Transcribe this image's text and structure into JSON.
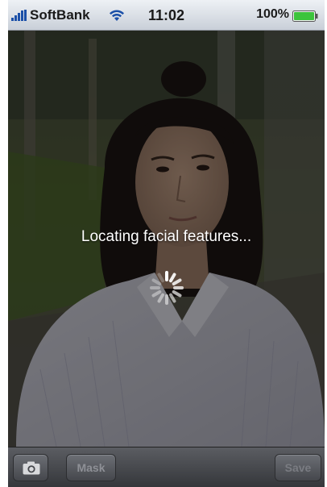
{
  "status_bar": {
    "carrier": "SoftBank",
    "time": "11:02",
    "battery_percent": "100%",
    "icons": [
      "signal-bars-icon",
      "wifi-icon",
      "battery-icon"
    ],
    "battery_level": 1.0
  },
  "main": {
    "status_message": "Locating facial features...",
    "spinner": "activity-spinner-icon"
  },
  "toolbar": {
    "camera_icon": "camera-icon",
    "mask_label": "Mask",
    "save_label": "Save"
  },
  "colors": {
    "status_bar": "#d4d9e0",
    "toolbar": "#45474c",
    "button_text_disabled": "#8e9096",
    "battery_fill": "#3cc43c"
  }
}
